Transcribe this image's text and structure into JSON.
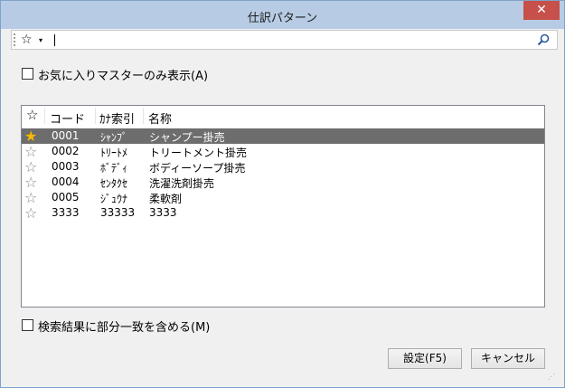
{
  "window": {
    "title": "仕訳パターン",
    "close_label": "✕"
  },
  "toolbar": {
    "star_glyph": "☆",
    "caret_glyph": "▾",
    "search_value": ""
  },
  "options": {
    "favorites_only_label": "お気に入りマスターのみ表示(A)",
    "partial_match_label": "検索結果に部分一致を含める(M)",
    "favorites_only_checked": false,
    "partial_match_checked": false
  },
  "table": {
    "header_star": "☆",
    "columns": [
      "コード",
      "ｶﾅ索引",
      "名称"
    ],
    "rows": [
      {
        "fav": true,
        "code": "0001",
        "kana": "ｼｬﾝﾌﾟ",
        "name": "シャンプー掛売",
        "selected": true
      },
      {
        "fav": false,
        "code": "0002",
        "kana": "ﾄﾘｰﾄﾒ",
        "name": "トリートメント掛売",
        "selected": false
      },
      {
        "fav": false,
        "code": "0003",
        "kana": "ﾎﾞﾃﾞｨ",
        "name": "ボディーソープ掛売",
        "selected": false
      },
      {
        "fav": false,
        "code": "0004",
        "kana": "ｾﾝﾀｸｾ",
        "name": "洗濯洗剤掛売",
        "selected": false
      },
      {
        "fav": false,
        "code": "0005",
        "kana": "ｼﾞｭｳﾅ",
        "name": "柔軟剤",
        "selected": false
      },
      {
        "fav": false,
        "code": "3333",
        "kana": "33333",
        "name": "3333",
        "selected": false
      }
    ]
  },
  "buttons": {
    "ok_label": "設定(F5)",
    "cancel_label": "キャンセル"
  },
  "colors": {
    "titlebar": "#b7cce4",
    "close": "#c7504a",
    "selection": "#6d6d6d",
    "fav_star": "#f5b700"
  }
}
